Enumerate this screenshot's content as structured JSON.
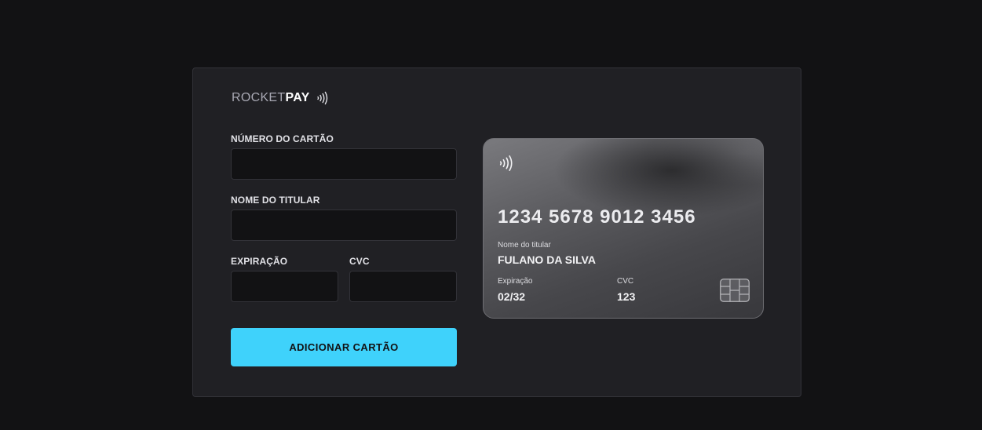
{
  "logo": {
    "light": "ROCKET",
    "bold": "PAY",
    "icon": "contactless-icon"
  },
  "form": {
    "card_number": {
      "label": "NÚMERO DO CARTÃO",
      "value": "",
      "placeholder": ""
    },
    "holder_name": {
      "label": "NOME DO TITULAR",
      "value": "",
      "placeholder": ""
    },
    "expiration": {
      "label": "EXPIRAÇÃO",
      "value": "",
      "placeholder": ""
    },
    "cvc": {
      "label": "CVC",
      "value": "",
      "placeholder": ""
    },
    "submit_label": "ADICIONAR CARTÃO"
  },
  "card": {
    "icon": "contactless-icon",
    "number": "1234 5678 9012 3456",
    "holder_label": "Nome do titular",
    "holder_value": "FULANO DA SILVA",
    "expiration_label": "Expiração",
    "expiration_value": "02/32",
    "cvc_label": "CVC",
    "cvc_value": "123",
    "chip_icon": "card-chip-icon"
  },
  "colors": {
    "background": "#121214",
    "panel": "#202024",
    "accent": "#3fd2fb",
    "input_bg": "#121214"
  }
}
